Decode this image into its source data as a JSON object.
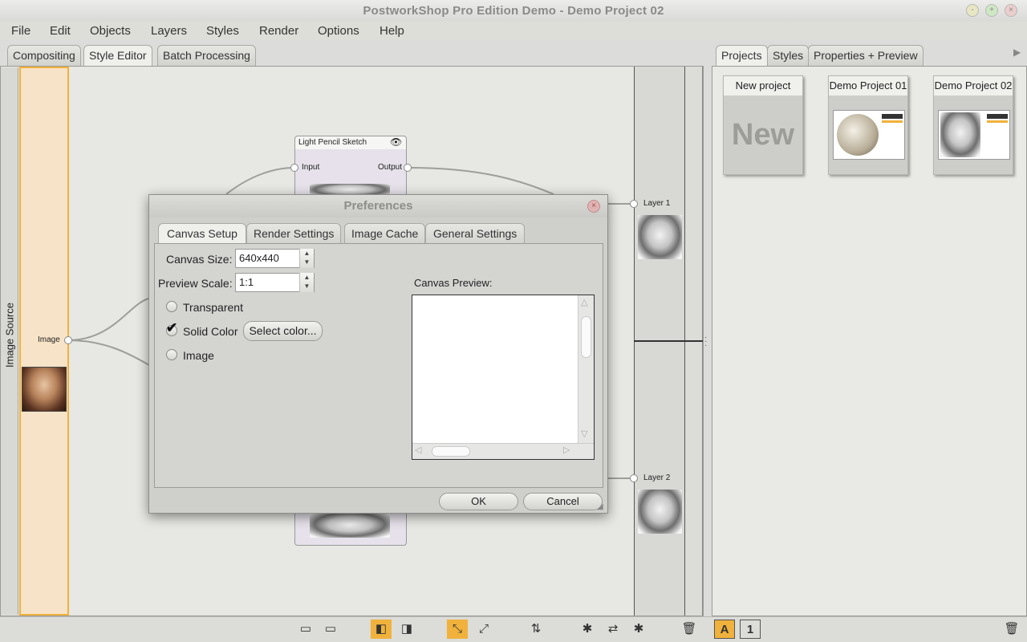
{
  "window": {
    "title": "PostworkShop Pro Edition Demo - Demo Project 02",
    "buttons": [
      "-",
      "+",
      "×"
    ]
  },
  "menu": [
    "File",
    "Edit",
    "Objects",
    "Layers",
    "Styles",
    "Render",
    "Options",
    "Help"
  ],
  "left_tabs": [
    "Compositing",
    "Style Editor",
    "Batch Processing"
  ],
  "active_left_tab": "Style Editor",
  "right_tabs": [
    "Projects",
    "Styles",
    "Properties + Preview"
  ],
  "active_right_tab": "Projects",
  "right_tabs_arrow": "▶",
  "image_source": {
    "label": "Image Source",
    "port_label": "Image"
  },
  "node": {
    "title": "Light Pencil Sketch",
    "input_label": "Input",
    "output_label": "Output"
  },
  "layers": [
    {
      "label": "Layer 1"
    },
    {
      "label": "Layer 2"
    }
  ],
  "projects": [
    {
      "title": "New project",
      "thumb_text": "New"
    },
    {
      "title": "Demo Project 01"
    },
    {
      "title": "Demo Project 02"
    }
  ],
  "dialog": {
    "title": "Preferences",
    "tabs": [
      "Canvas Setup",
      "Render Settings",
      "Image Cache",
      "General Settings"
    ],
    "active_tab": "Canvas Setup",
    "canvas_size_label": "Canvas Size:",
    "canvas_size_value": "640x440",
    "preview_scale_label": "Preview Scale:",
    "preview_scale_value": "1:1",
    "options": [
      {
        "label": "Transparent",
        "checked": false
      },
      {
        "label": "Solid Color",
        "checked": true
      },
      {
        "label": "Image",
        "checked": false
      }
    ],
    "select_color_label": "Select color...",
    "canvas_preview_label": "Canvas Preview:",
    "ok_label": "OK",
    "cancel_label": "Cancel"
  },
  "bottom_tools_right": [
    "A",
    "1"
  ],
  "colors": {
    "accent": "#f0b23c",
    "image_source_bg": "#f7e3c7",
    "node_body": "#e6e1ea",
    "workspace_bg": "#e7e7e3"
  }
}
